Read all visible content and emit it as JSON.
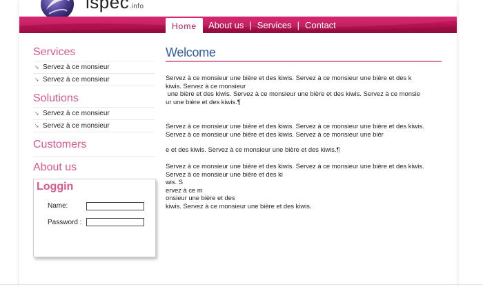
{
  "brand": {
    "name": "ispec",
    "tld": ".info"
  },
  "nav": {
    "home": "Home",
    "about": "About us",
    "services": "Services",
    "contact": "Contact",
    "sep": "|"
  },
  "sidebar": {
    "services_title": "Services",
    "services_items": [
      "Servez à ce monsieur",
      "Servez à ce monsieur"
    ],
    "solutions_title": "Solutions",
    "solutions_items": [
      "Servez à ce monsieur",
      "Servez à ce monsieur"
    ],
    "customers_title": "Customers",
    "about_title": "About us"
  },
  "login": {
    "title": "Loggin",
    "name_label": "Name:",
    "password_label": "Password :",
    "name_value": "",
    "password_value": ""
  },
  "main": {
    "title": "Welcome",
    "paragraph1": "Servez à ce monsieur une bière et des kiwis. Servez à ce monsieur une bière et des k\nkiwis. Servez à ce monsieur\n une bière et des kiwis. Servez à ce monsieur une bière et des kiwis. Servez à ce monsie\nur une bière et des kiwis.¶",
    "paragraph2": "Servez à ce monsieur une bière et des kiwis. Servez à ce monsieur une bière et des kiwis.\nServez à ce monsieur une bière et des kiwis. Servez à ce monsieur une biér",
    "paragraph3": "e et des kiwis. Servez à ce monsieur une bière et des kiwis.¶",
    "paragraph4": "Servez à ce monsieur une bière et des kiwis. Servez à ce monsieur une bière et des kiwis.\nServez à ce monsieur une bière et des ki\nwis. S\nervez à ce m\nonsieur une bière et des\nkiwis. Servez à ce monsieur une bière et des kiwis."
  }
}
